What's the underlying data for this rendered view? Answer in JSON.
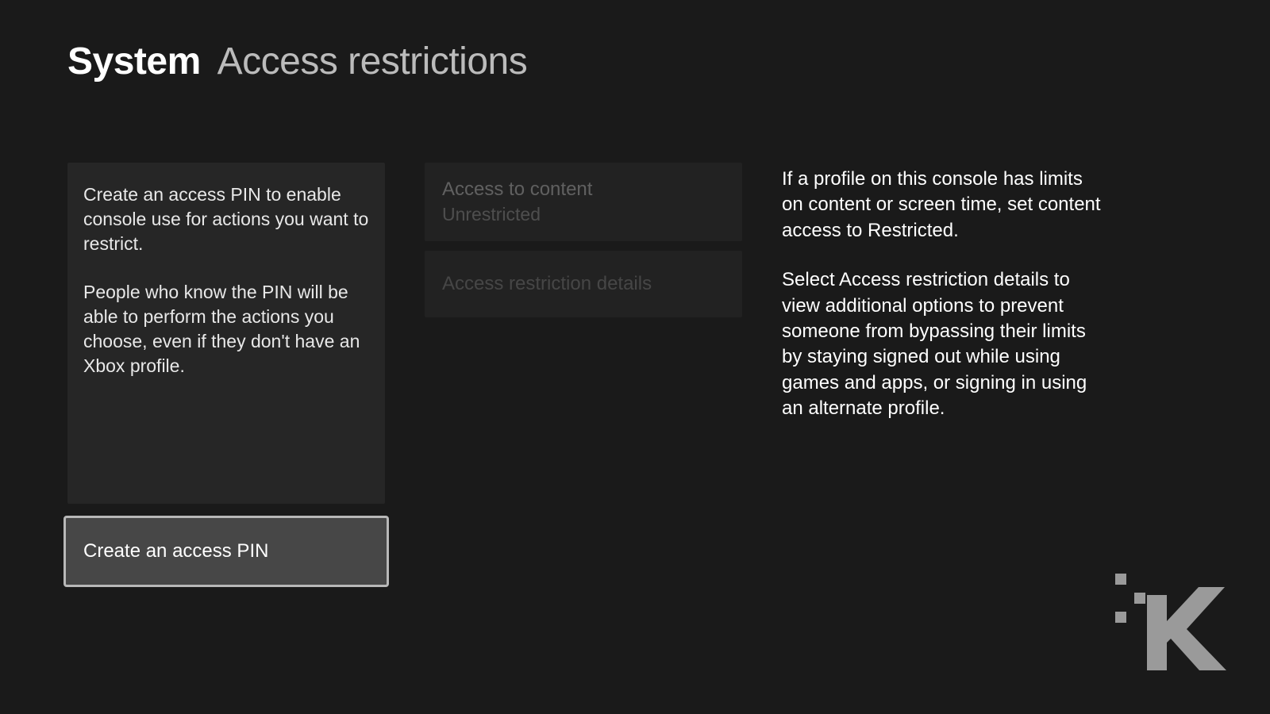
{
  "header": {
    "title_bold": "System",
    "title_light": "Access restrictions"
  },
  "left": {
    "paragraph1": "Create an access PIN to enable console use for actions you want to restrict.",
    "paragraph2": "People who know the PIN will be able to perform the actions you choose, even if they don't have an Xbox profile.",
    "button_label": "Create an access PIN"
  },
  "middle": {
    "access_content": {
      "title": "Access to content",
      "value": "Unrestricted"
    },
    "restriction_details": {
      "title": "Access restriction details"
    }
  },
  "right": {
    "paragraph1": "If a profile on this console has limits on content or screen time, set content access to Restricted.",
    "paragraph2": "Select Access restriction details to view additional options to prevent someone from bypassing their limits by staying signed out while using games and apps, or signing in using an alternate profile."
  },
  "watermark": {
    "name": "K"
  }
}
